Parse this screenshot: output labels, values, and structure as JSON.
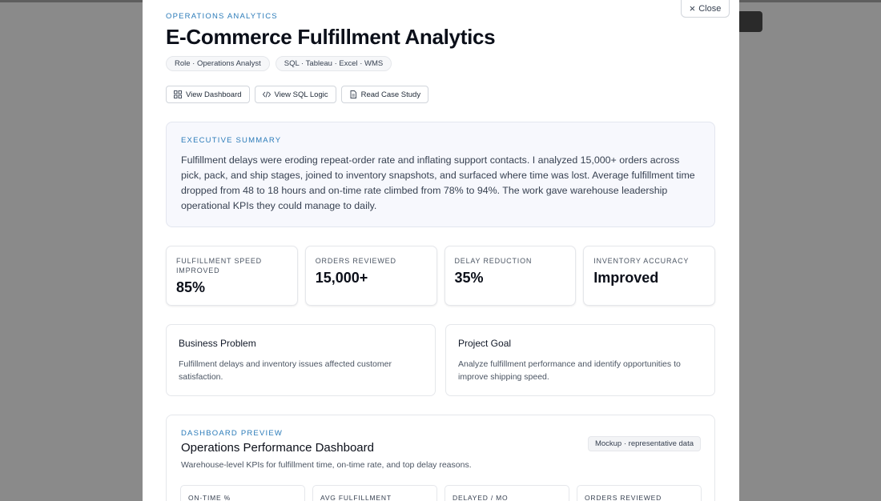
{
  "modal": {
    "close_label": "Close",
    "eyebrow": "OPERATIONS ANALYTICS",
    "title": "E-Commerce Fulfillment Analytics",
    "chips": [
      "Role · Operations Analyst",
      "SQL · Tableau · Excel · WMS"
    ],
    "actions": [
      {
        "label": "View Dashboard",
        "icon": "grid-icon"
      },
      {
        "label": "View SQL Logic",
        "icon": "code-icon"
      },
      {
        "label": "Read Case Study",
        "icon": "document-icon"
      }
    ]
  },
  "summary": {
    "label": "EXECUTIVE SUMMARY",
    "text": "Fulfillment delays were eroding repeat-order rate and inflating support contacts. I analyzed 15,000+ orders across pick, pack, and ship stages, joined to inventory snapshots, and surfaced where time was lost. Average fulfillment time dropped from 48 to 18 hours and on-time rate climbed from 78% to 94%. The work gave warehouse leadership operational KPIs they could manage to daily."
  },
  "stats": [
    {
      "label": "FULFILLMENT SPEED IMPROVED",
      "value": "85%"
    },
    {
      "label": "ORDERS REVIEWED",
      "value": "15,000+"
    },
    {
      "label": "DELAY REDUCTION",
      "value": "35%"
    },
    {
      "label": "INVENTORY ACCURACY",
      "value": "Improved"
    }
  ],
  "cards": [
    {
      "title": "Business Problem",
      "text": "Fulfillment delays and inventory issues affected customer satisfaction."
    },
    {
      "title": "Project Goal",
      "text": "Analyze fulfillment performance and identify opportunities to improve shipping speed."
    }
  ],
  "dashboard": {
    "label": "DASHBOARD PREVIEW",
    "title": "Operations Performance Dashboard",
    "subtitle": "Warehouse-level KPIs for fulfillment time, on-time rate, and top delay reasons.",
    "badge": "Mockup · representative data",
    "kpis": [
      "ON-TIME %",
      "AVG FULFILLMENT",
      "DELAYED / MO",
      "ORDERS REVIEWED"
    ]
  },
  "colors": {
    "accent": "#2b7bb9",
    "overlay": "#8a8a8a"
  }
}
